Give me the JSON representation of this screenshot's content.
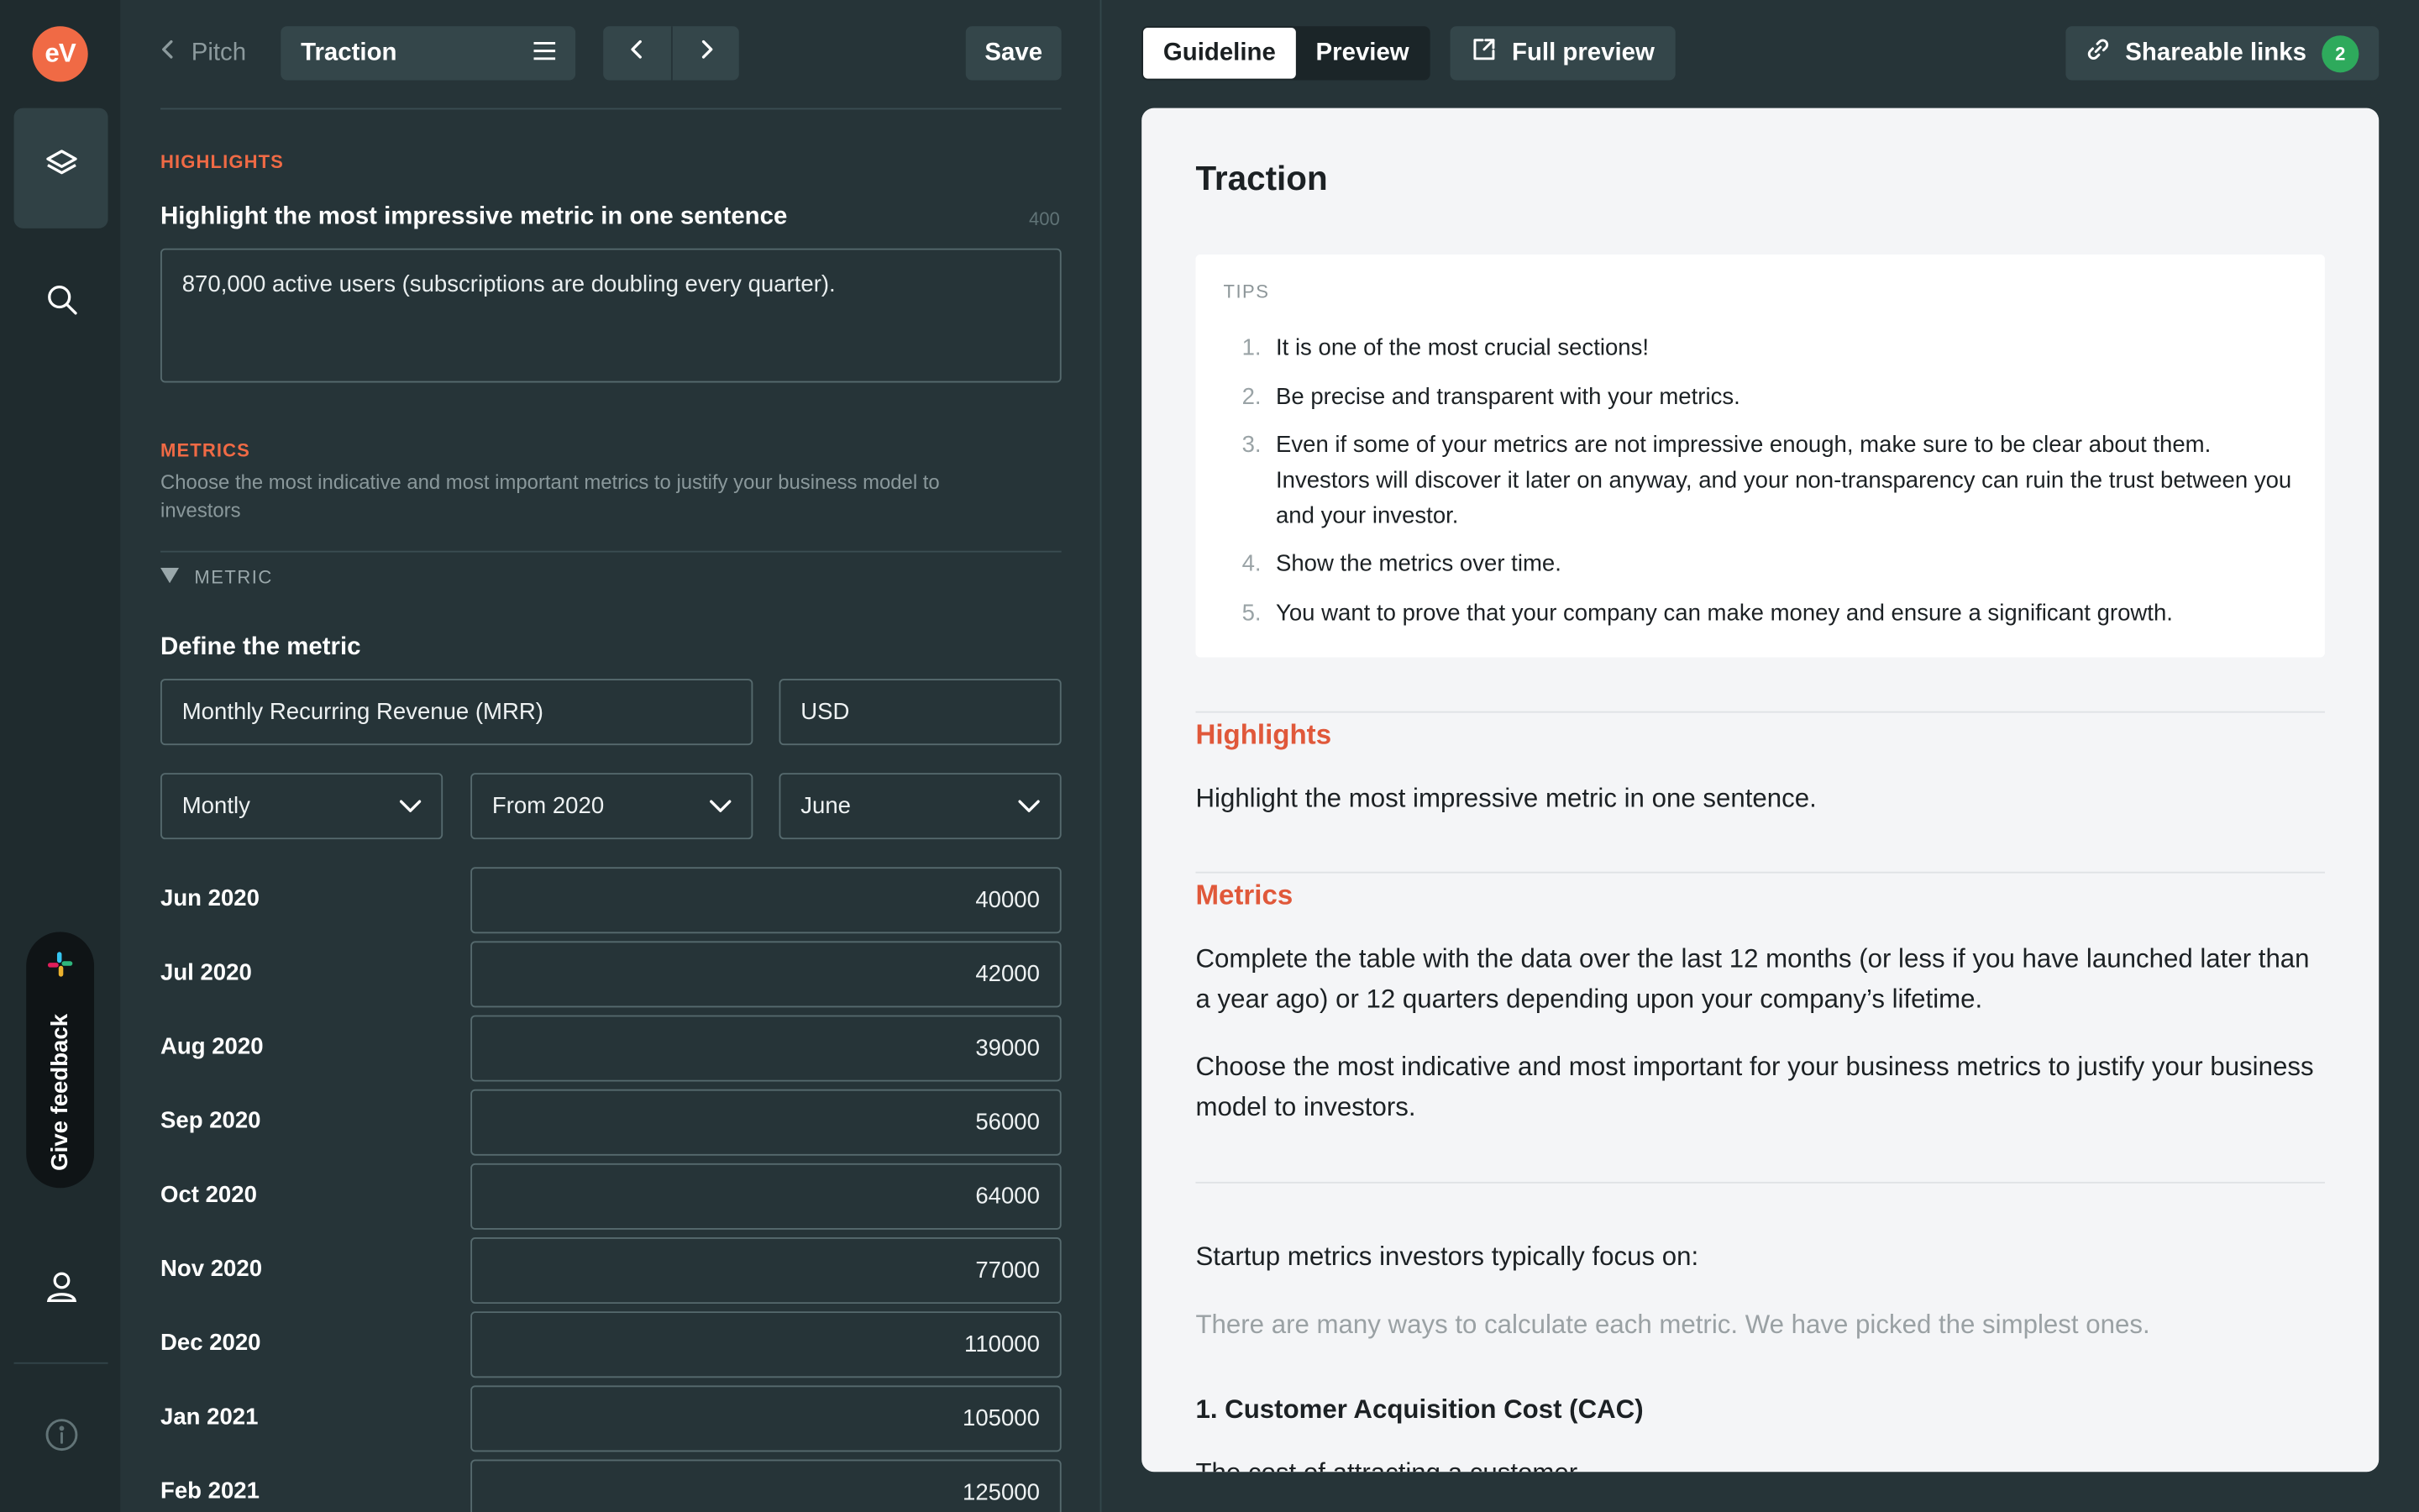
{
  "sidebar": {
    "logo_text": "eV",
    "feedback_label": "Give feedback"
  },
  "left": {
    "back_label": "Pitch",
    "section_name": "Traction",
    "save_label": "Save",
    "highlights": {
      "eyebrow": "HIGHLIGHTS",
      "question": "Highlight the most impressive metric in one sentence",
      "char_count": "400",
      "value": "870,000 active users (subscriptions are doubling every quarter)."
    },
    "metrics": {
      "eyebrow": "METRICS",
      "help": "Choose the most indicative and most important metrics to justify your business model to investors",
      "toggle_label": "METRIC",
      "define_label": "Define the metric",
      "metric_name": "Monthly Recurring Revenue (MRR)",
      "currency": "USD",
      "frequency": "Montly",
      "from": "From 2020",
      "month": "June",
      "rows": [
        {
          "label": "Jun 2020",
          "value": "40000"
        },
        {
          "label": "Jul 2020",
          "value": "42000"
        },
        {
          "label": "Aug 2020",
          "value": "39000"
        },
        {
          "label": "Sep 2020",
          "value": "56000"
        },
        {
          "label": "Oct 2020",
          "value": "64000"
        },
        {
          "label": "Nov 2020",
          "value": "77000"
        },
        {
          "label": "Dec 2020",
          "value": "110000"
        },
        {
          "label": "Jan 2021",
          "value": "105000"
        },
        {
          "label": "Feb 2021",
          "value": "125000"
        }
      ]
    }
  },
  "right": {
    "tabs": [
      "Guideline",
      "Preview"
    ],
    "full_preview_label": "Full preview",
    "share_label": "Shareable links",
    "share_count": "2",
    "card": {
      "title": "Traction",
      "tips_title": "TIPS",
      "tips": [
        "It is one of the most crucial sections!",
        "Be precise and transparent with your metrics.",
        "Even if some of your metrics are not impressive enough, make sure to be clear about them. Investors will discover it later on anyway, and your non-transparency can ruin the trust between you and your investor.",
        "Show the metrics over time.",
        "You want to prove that your company can make money and ensure a significant growth."
      ],
      "highlights_heading": "Highlights",
      "highlights_text": "Highlight the most impressive metric in one sentence.",
      "metrics_heading": "Metrics",
      "metrics_p1": "Complete the table with the data over the last 12 months (or less if you have launched later than a year ago) or 12 quarters depending upon your company’s lifetime.",
      "metrics_p2": "Choose the most indicative and most important for your business metrics to justify your business model to investors.",
      "focus_text": "Startup metrics investors typically focus on:",
      "focus_muted": "There are many ways to calculate each metric. We have picked the simplest ones.",
      "cac_heading": "1. Customer Acquisition Cost (CAC)",
      "cac_text": "The cost of attracting a customer"
    }
  }
}
